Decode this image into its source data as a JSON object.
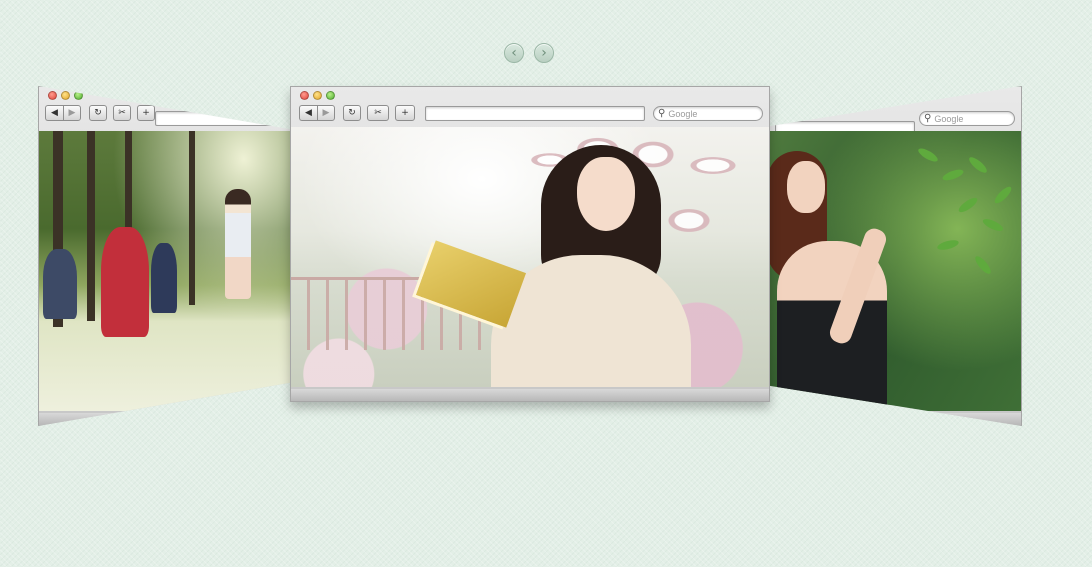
{
  "carousel": {
    "prev_icon": "chevron-left-icon",
    "next_icon": "chevron-right-icon",
    "prev_glyph": "‹",
    "next_glyph": "›"
  },
  "browser": {
    "back_glyph": "◀",
    "forward_glyph": "▶",
    "reload_glyph": "↻",
    "snap_glyph": "✂",
    "add_glyph": "+",
    "search_icon_glyph": "⚲",
    "search_placeholder": "Google"
  },
  "slides": [
    {
      "id": "left",
      "photo": "woman-walking-in-park-with-cyclists"
    },
    {
      "id": "center",
      "photo": "woman-reading-yellow-book-among-hydrangeas"
    },
    {
      "id": "right",
      "photo": "woman-in-black-dress-holding-branch"
    }
  ],
  "colors": {
    "background": "#e3efe7",
    "nav_button": "#c5dbcd",
    "browser_chrome": "#d6d6d6"
  }
}
